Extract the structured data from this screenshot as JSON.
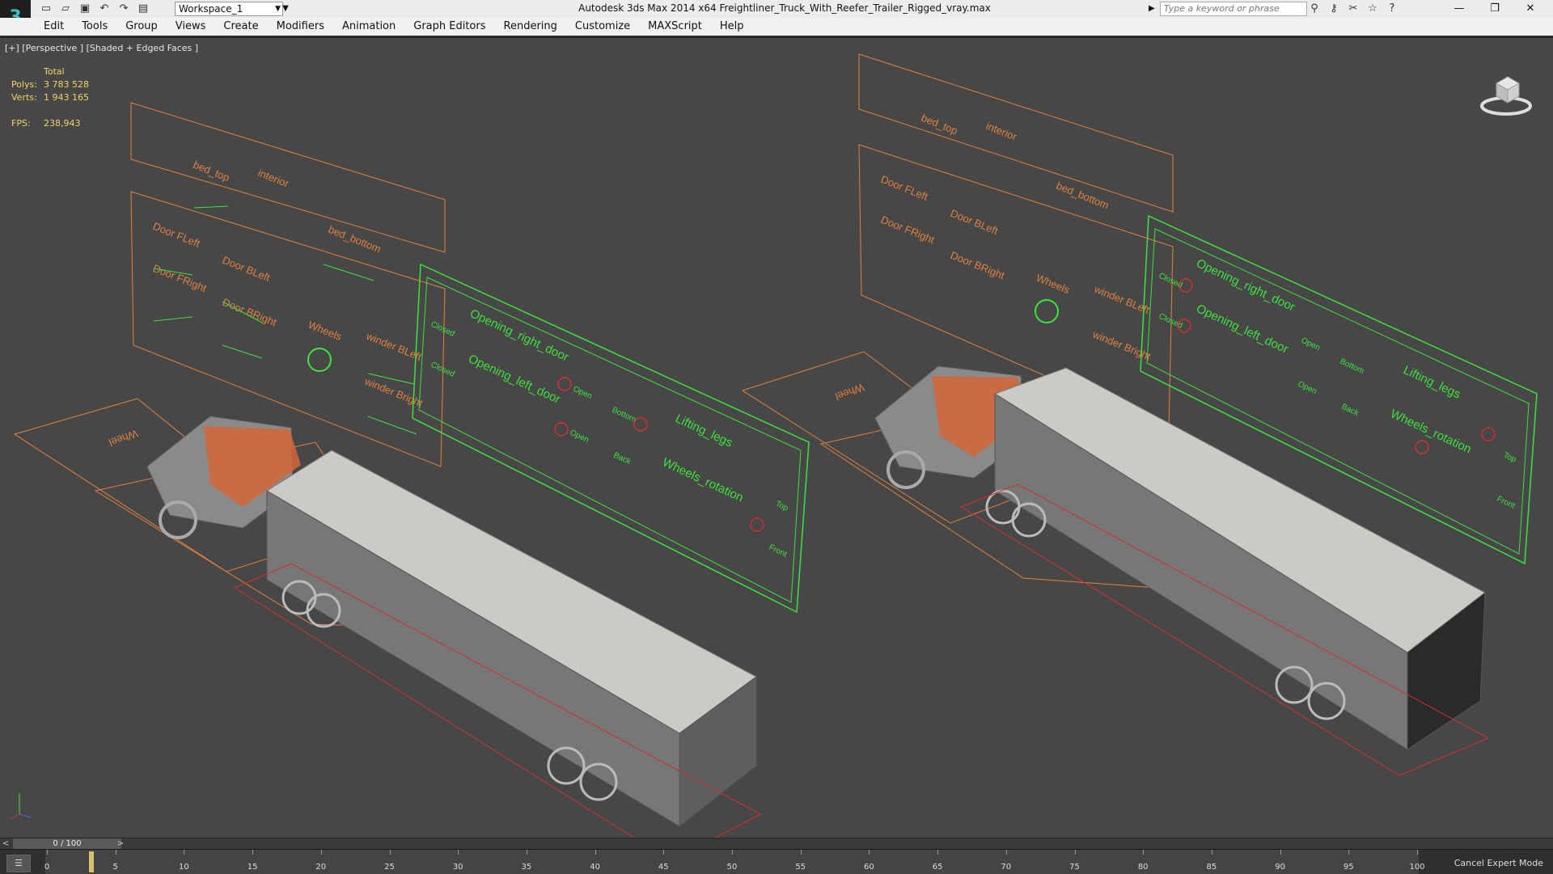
{
  "titlebar": {
    "workspace": "Workspace_1",
    "title": "Autodesk 3ds Max  2014 x64    Freightliner_Truck_With_Reefer_Trailer_Rigged_vray.max",
    "search_placeholder": "Type a keyword or phrase",
    "icons": [
      "new-icon",
      "open-icon",
      "save-icon",
      "undo-icon",
      "redo-icon",
      "project-icon"
    ],
    "right_icons": [
      "binoculars-icon",
      "key-icon",
      "tools-icon",
      "star-icon",
      "help-icon"
    ]
  },
  "menu": {
    "items": [
      "Edit",
      "Tools",
      "Group",
      "Views",
      "Create",
      "Modifiers",
      "Animation",
      "Graph Editors",
      "Rendering",
      "Customize",
      "MAXScript",
      "Help"
    ]
  },
  "viewport": {
    "label": "[+] [Perspective ] [Shaded + Edged Faces ]",
    "stats": {
      "header": "Total",
      "polys_label": "Polys:",
      "polys": "3 783 528",
      "verts_label": "Verts:",
      "verts": "1 943 165",
      "fps_label": "FPS:",
      "fps": "238,943"
    },
    "rig_labels": {
      "bed_top": "bed_top",
      "interior": "interior",
      "bed_bottom": "bed_bottom",
      "door_fleft": "Door FLeft",
      "door_fright": "Door FRight",
      "door_bleft": "Door BLeft",
      "door_bright": "Door BRight",
      "wheels": "Wheels",
      "winder_bleft": "winder BLeft",
      "winder_bright": "winder Bright",
      "wheel": "Wheel",
      "opening_right_door": "Opening_right_door",
      "opening_left_door": "Opening_left_door",
      "closed": "Closed",
      "open": "Open",
      "bottom": "Bottom",
      "back": "Back",
      "lifting_legs": "Lifting_legs",
      "wheels_rotation": "Wheels_rotation",
      "top": "Top",
      "front": "Front"
    },
    "colors": {
      "orange": "#e08040",
      "green": "#3fe03f",
      "red": "#d23030",
      "mesh": "#9a9a9a",
      "roof": "#c9c9c4"
    }
  },
  "timeline": {
    "frame": "0 / 100",
    "prev": "<",
    "next": ">",
    "ticks": [
      "0",
      "5",
      "10",
      "15",
      "20",
      "25",
      "30",
      "35",
      "40",
      "45",
      "50",
      "55",
      "60",
      "65",
      "70",
      "75",
      "80",
      "85",
      "90",
      "95",
      "100"
    ],
    "cancel_expert": "Cancel Expert Mode"
  }
}
